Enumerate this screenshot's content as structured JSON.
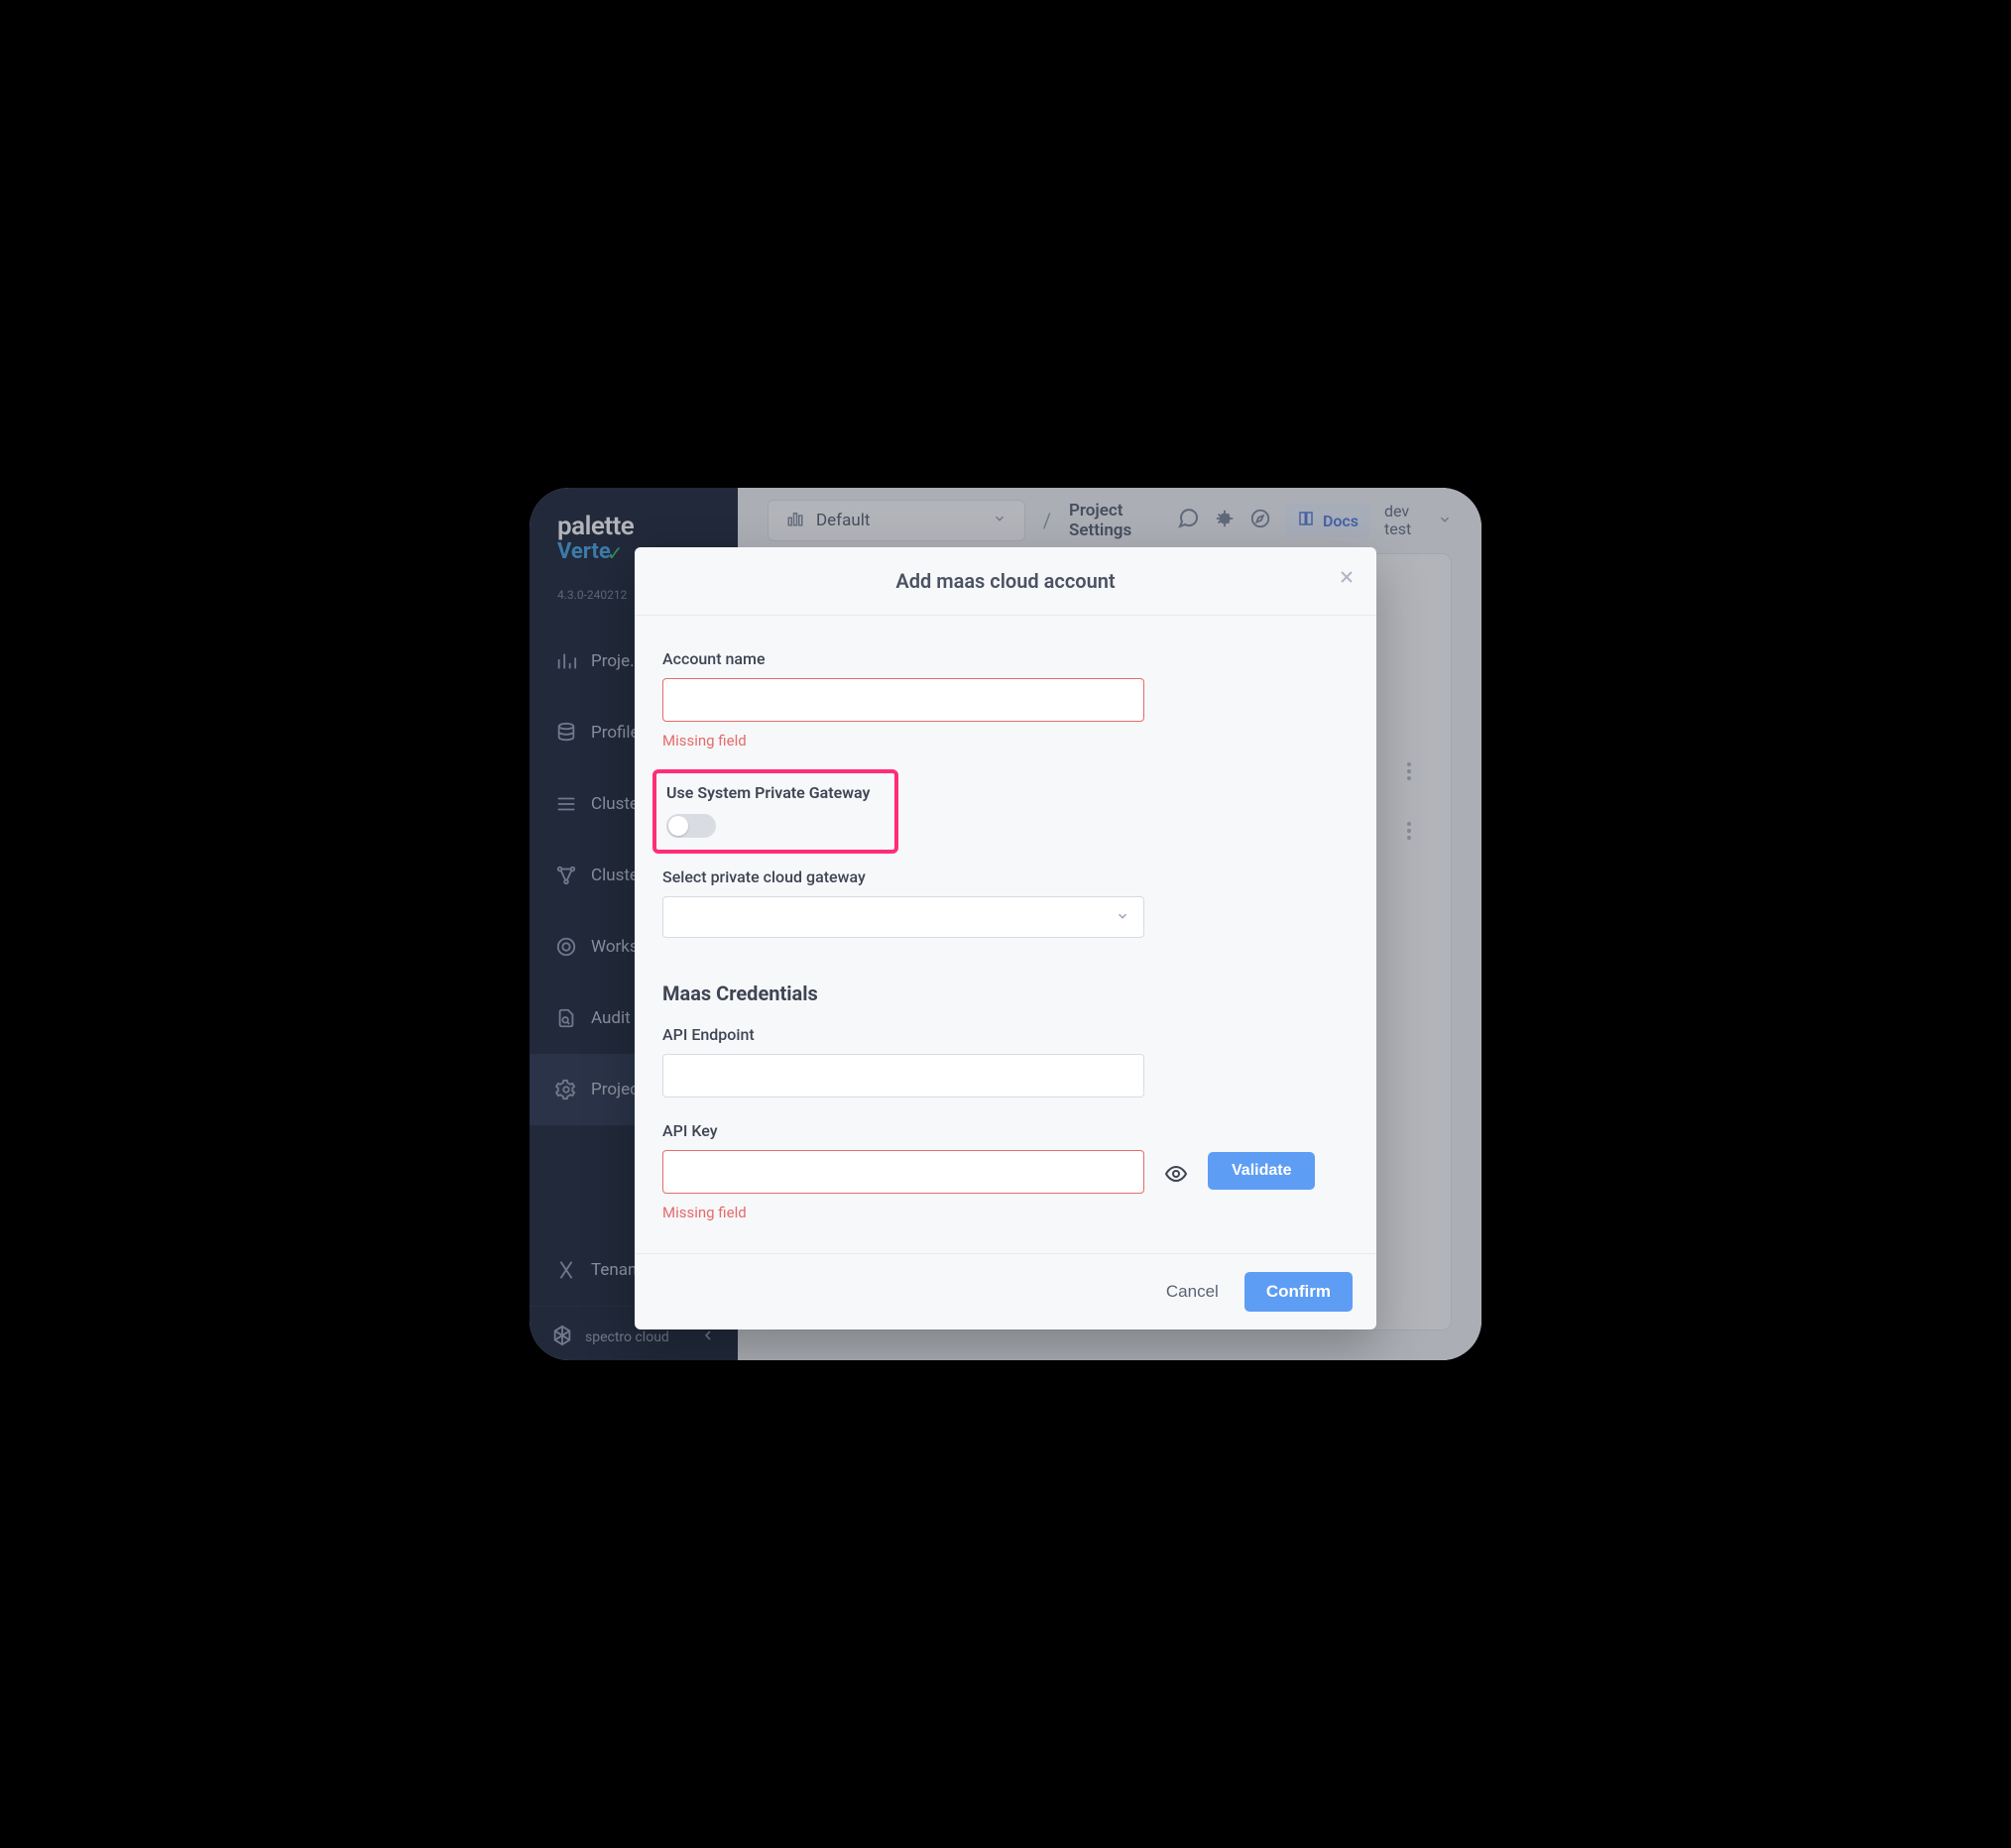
{
  "brand": {
    "name": "palette",
    "accent": "Verte",
    "check": "✓"
  },
  "version": "4.3.0-240212",
  "sidebar": {
    "items": [
      {
        "label": "Proje…"
      },
      {
        "label": "Profile"
      },
      {
        "label": "Cluste"
      },
      {
        "label": "Cluste"
      },
      {
        "label": "Works"
      },
      {
        "label": "Audit"
      },
      {
        "label": "Projec"
      }
    ],
    "tenant_item": "Tenan",
    "footer": "spectro cloud"
  },
  "topbar": {
    "project_selector": "Default",
    "breadcrumb": "Project Settings",
    "docs_label": "Docs",
    "tenant": "dev test"
  },
  "modal": {
    "title": "Add maas cloud account",
    "account_name_label": "Account name",
    "account_name_value": "",
    "account_name_error": "Missing field",
    "toggle_label": "Use System Private Gateway",
    "toggle_on": false,
    "gateway_label": "Select private cloud gateway",
    "gateway_value": "",
    "credentials_heading": "Maas Credentials",
    "api_endpoint_label": "API Endpoint",
    "api_endpoint_value": "",
    "api_key_label": "API Key",
    "api_key_value": "",
    "api_key_error": "Missing field",
    "validate_label": "Validate",
    "cancel_label": "Cancel",
    "confirm_label": "Confirm"
  },
  "colors": {
    "accent": "#5e9df4",
    "error": "#e46b6b",
    "highlight": "#ff2d78",
    "sidebar_bg": "#212a3d"
  }
}
